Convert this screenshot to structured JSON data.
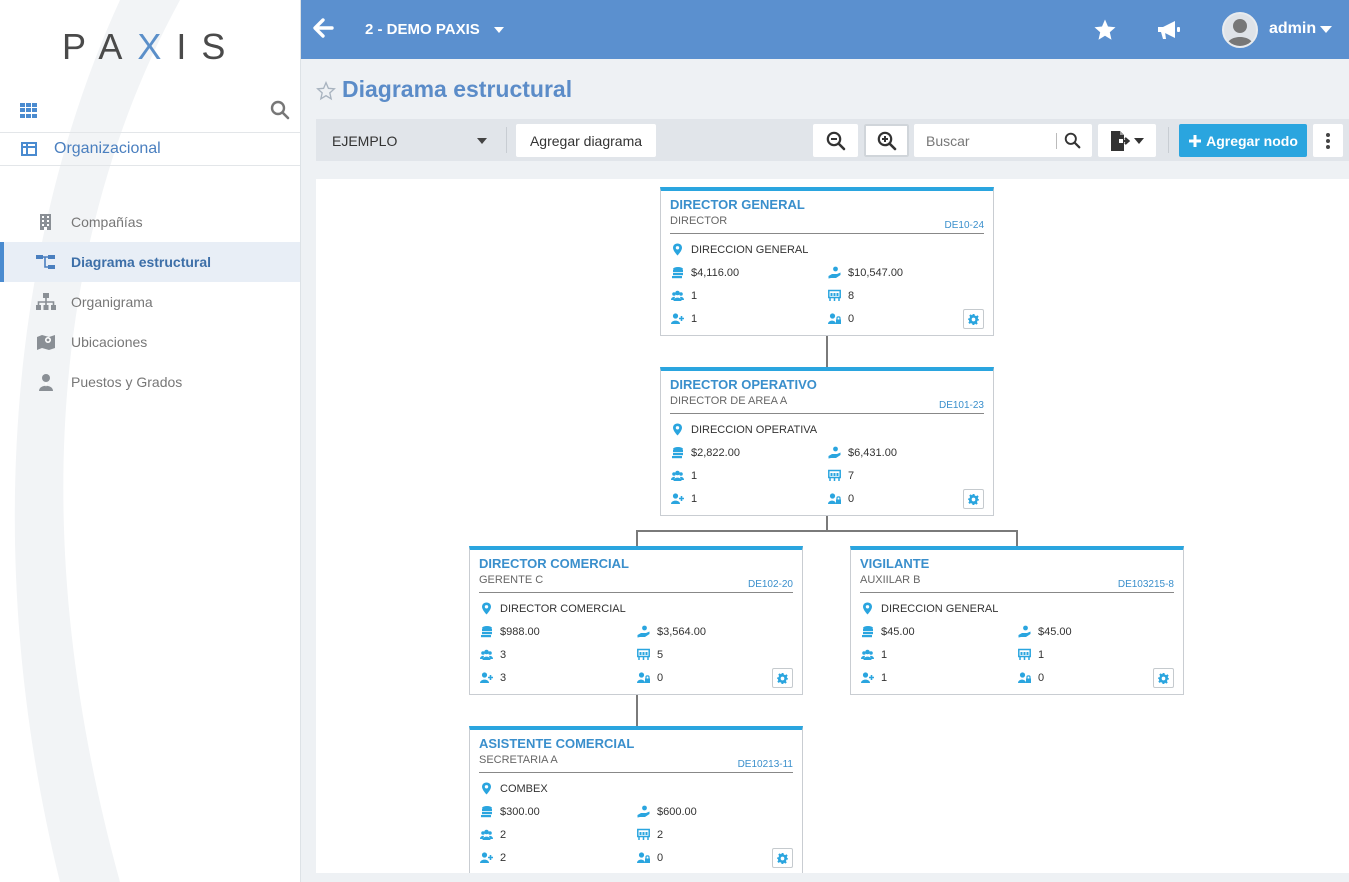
{
  "sidebar": {
    "logo": {
      "p": "PA",
      "x": "X",
      "rest": "IS"
    },
    "section_label": "Organizacional",
    "items": [
      {
        "label": "Compañías",
        "icon": "building-icon"
      },
      {
        "label": "Diagrama estructural",
        "icon": "hierarchy-icon",
        "active": true
      },
      {
        "label": "Organigrama",
        "icon": "sitemap-icon"
      },
      {
        "label": "Ubicaciones",
        "icon": "map-icon"
      },
      {
        "label": "Puestos y Grados",
        "icon": "user-tie-icon"
      }
    ]
  },
  "header": {
    "company": "2 - DEMO PAXIS",
    "user": "admin"
  },
  "page": {
    "title": "Diagrama estructural"
  },
  "toolbar": {
    "selected_diagram": "EJEMPLO",
    "add_diagram": "Agregar diagrama",
    "search_placeholder": "Buscar",
    "add_node": "Agregar nodo"
  },
  "colors": {
    "accent": "#2aa5df",
    "header": "#5b90cf",
    "title": "#5b8cc8"
  },
  "nodes": [
    {
      "title": "DIRECTOR GENERAL",
      "subtitle": "DIRECTOR",
      "code": "DE10-24",
      "location": "DIRECCION GENERAL",
      "cost": "$4,116.00",
      "budget": "$10,547.00",
      "employees": "1",
      "positions": "8",
      "new_hires": "1",
      "vacancies": "0"
    },
    {
      "title": "DIRECTOR OPERATIVO",
      "subtitle": "DIRECTOR DE AREA A",
      "code": "DE101-23",
      "location": "DIRECCION OPERATIVA",
      "cost": "$2,822.00",
      "budget": "$6,431.00",
      "employees": "1",
      "positions": "7",
      "new_hires": "1",
      "vacancies": "0"
    },
    {
      "title": "DIRECTOR COMERCIAL",
      "subtitle": "GERENTE C",
      "code": "DE102-20",
      "location": "DIRECTOR COMERCIAL",
      "cost": "$988.00",
      "budget": "$3,564.00",
      "employees": "3",
      "positions": "5",
      "new_hires": "3",
      "vacancies": "0"
    },
    {
      "title": "VIGILANTE",
      "subtitle": "AUXIILAR B",
      "code": "DE103215-8",
      "location": "DIRECCION GENERAL",
      "cost": "$45.00",
      "budget": "$45.00",
      "employees": "1",
      "positions": "1",
      "new_hires": "1",
      "vacancies": "0"
    },
    {
      "title": "ASISTENTE COMERCIAL",
      "subtitle": "SECRETARIA A",
      "code": "DE10213-11",
      "location": "COMBEX",
      "cost": "$300.00",
      "budget": "$600.00",
      "employees": "2",
      "positions": "2",
      "new_hires": "2",
      "vacancies": "0"
    }
  ]
}
